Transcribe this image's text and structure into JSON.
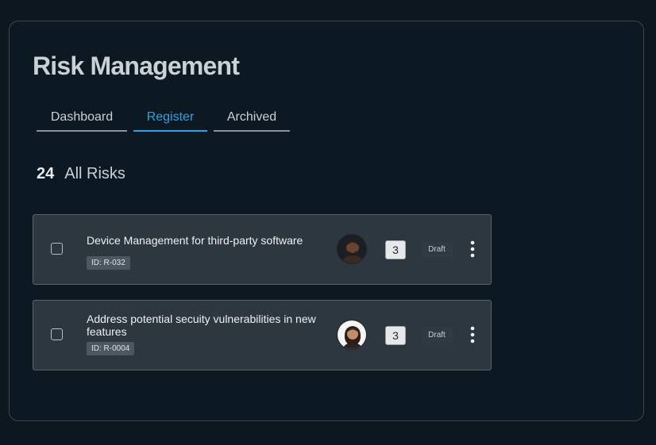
{
  "header": {
    "title": "Risk Management"
  },
  "tabs": [
    {
      "label": "Dashboard",
      "active": false
    },
    {
      "label": "Register",
      "active": true
    },
    {
      "label": "Archived",
      "active": false
    }
  ],
  "summary": {
    "count": "24",
    "label": "All Risks"
  },
  "risks": [
    {
      "title": "Device Management for third-party software",
      "id": "ID: R-032",
      "count": "3",
      "status": "Draft",
      "checked": false,
      "avatar_icon": "person-avatar-icon"
    },
    {
      "title": "Address potential secuity vulnerabilities in new features",
      "id": "ID: R-0004",
      "count": "3",
      "status": "Draft",
      "checked": false,
      "avatar_icon": "person-avatar-icon"
    }
  ],
  "colors": {
    "background": "#0c1720",
    "accent": "#2fa3e0",
    "card": "#2d373f"
  }
}
